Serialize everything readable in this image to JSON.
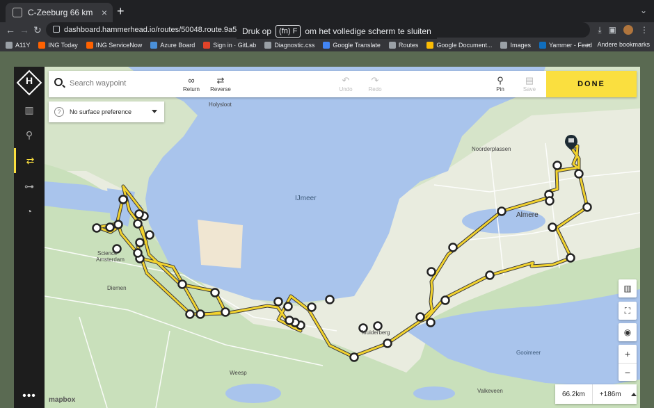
{
  "browser": {
    "tab_title": "C-Zeeburg 66 km",
    "url": "dashboard.hammerhead.io/routes/50048.route.9a5e7",
    "fullscreen_notice_prefix": "Druk op",
    "fullscreen_notice_key": "(fn) F",
    "fullscreen_notice_suffix": "om het volledige scherm te sluiten",
    "bookmarks": [
      {
        "label": "A11Y",
        "color": "#9aa0a6"
      },
      {
        "label": "ING Today",
        "color": "#ff6200"
      },
      {
        "label": "ING ServiceNow",
        "color": "#ff6200"
      },
      {
        "label": "Azure Board",
        "color": "#4a90d9"
      },
      {
        "label": "Sign in · GitLab",
        "color": "#e24329"
      },
      {
        "label": "Diagnostic.css",
        "color": "#9aa0a6"
      },
      {
        "label": "Google Translate",
        "color": "#4285f4"
      },
      {
        "label": "Routes",
        "color": "#9aa0a6"
      },
      {
        "label": "Google Document...",
        "color": "#fbbc04"
      },
      {
        "label": "Images",
        "color": "#9aa0a6"
      },
      {
        "label": "Yammer - Feed",
        "color": "#106ebe"
      }
    ],
    "bookmarks_more": "»",
    "other_bookmarks": "Andere bookmarks"
  },
  "toolbar": {
    "search_placeholder": "Search waypoint",
    "return_label": "Return",
    "reverse_label": "Reverse",
    "undo_label": "Undo",
    "redo_label": "Redo",
    "pin_label": "Pin",
    "save_label": "Save",
    "done_label": "DONE"
  },
  "surface": {
    "label": "No surface preference"
  },
  "stats": {
    "distance": "66.2km",
    "elevation": "+186m"
  },
  "attribution": "mapbox",
  "map_labels": {
    "ijmeer": "IJmeer",
    "almere": "Almere",
    "gooimeer": "Gooimeer",
    "noorderplassen": "Noorderplassen",
    "diemen": "Diemen",
    "weesp": "Weesp",
    "valkeveen": "Valkeveen",
    "holysloot": "Holysloot",
    "science": "Science",
    "amsterdam": "Amsterdam",
    "muiderberg": "Muiderberg"
  },
  "colors": {
    "accent": "#fadf3f",
    "water": "#a9c4ec",
    "land": "#e9ecdf",
    "green": "#c4dfb7",
    "route": "#f2d22e"
  }
}
